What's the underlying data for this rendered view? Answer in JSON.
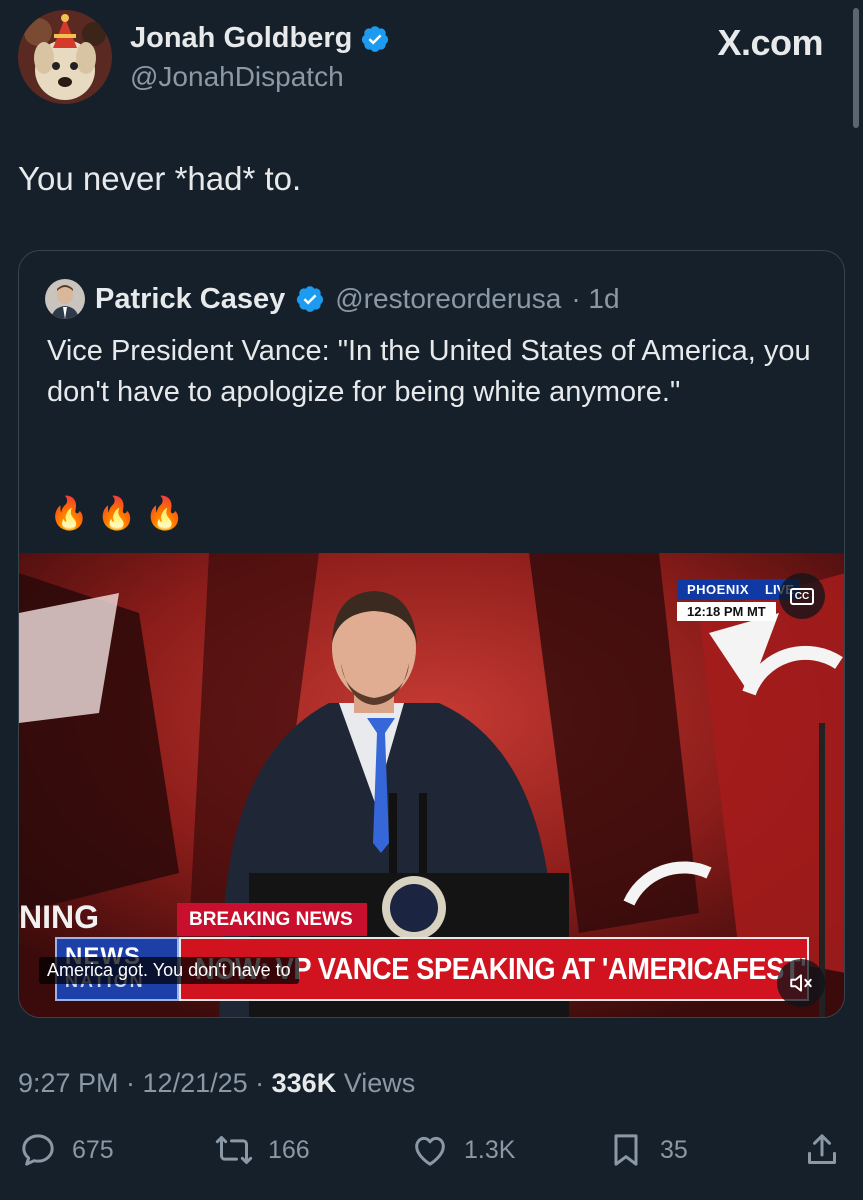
{
  "post": {
    "author_name": "Jonah Goldberg",
    "author_handle": "@JonahDispatch",
    "site_label": "X.com",
    "text": "You never *had* to.",
    "timestamp": "9:27 PM · 12/21/25 · ",
    "views_count": "336K",
    "views_label": " Views"
  },
  "quote": {
    "author_name": "Patrick Casey",
    "author_handle": "@restoreorderusa",
    "age": "· 1d",
    "text": "Vice President Vance: \"In the United States of America, you don't have to apologize for being white anymore.\"",
    "emoji": "🔥🔥🔥"
  },
  "video": {
    "location": "PHOENIX",
    "live_label": "LIVE",
    "time": "12:18 PM MT",
    "cc_label": "CC",
    "breaking": "BREAKING NEWS",
    "ticker": "NOW: VP VANCE SPEAKING AT 'AMERICAFEST'",
    "network_top": "NEWS",
    "network_bottom": "NATION",
    "left_edge_text": "NING",
    "caption": "America got. You don't have to"
  },
  "actions": {
    "replies": "675",
    "reposts": "166",
    "likes": "1.3K",
    "bookmarks": "35"
  },
  "colors": {
    "background": "#15202b",
    "verified": "#1d9bf0",
    "muted": "#8b98a5"
  }
}
